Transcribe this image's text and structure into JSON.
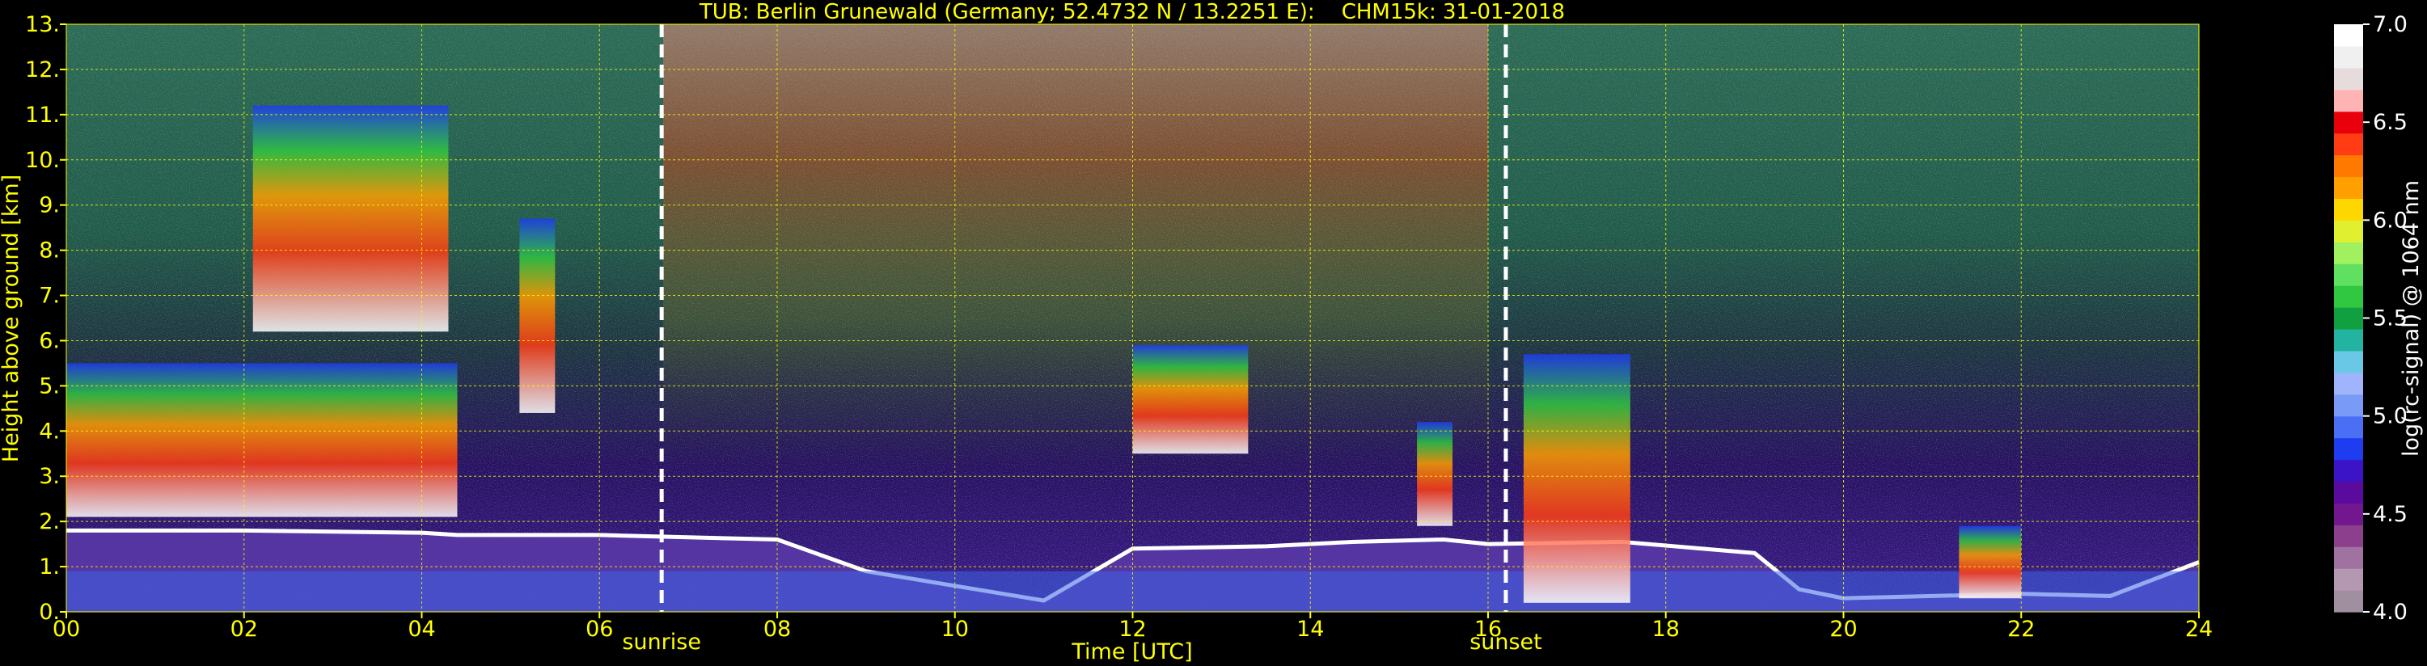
{
  "chart_data": {
    "type": "heatmap",
    "title": "TUB: Berlin Grunewald (Germany; 52.4732 N / 13.2251 E):    CHM15k: 31-01-2018",
    "xlabel": "Time [UTC]",
    "ylabel": "Height above ground [km]",
    "xlim": [
      0,
      24
    ],
    "ylim": [
      0,
      13
    ],
    "x_ticks": [
      "00",
      "02",
      "04",
      "06",
      "08",
      "10",
      "12",
      "14",
      "16",
      "18",
      "20",
      "22",
      "24"
    ],
    "x_tick_values": [
      0,
      2,
      4,
      6,
      8,
      10,
      12,
      14,
      16,
      18,
      20,
      22,
      24
    ],
    "y_ticks": [
      "0.",
      "1.",
      "2.",
      "3.",
      "4.",
      "5.",
      "6.",
      "7.",
      "8.",
      "9.",
      "10.",
      "11.",
      "12.",
      "13."
    ],
    "y_tick_values": [
      0,
      1,
      2,
      3,
      4,
      5,
      6,
      7,
      8,
      9,
      10,
      11,
      12,
      13
    ],
    "grid": true,
    "grid_color": "#ffff00",
    "annotations": [
      {
        "text": "sunrise",
        "x": 6.7
      },
      {
        "text": "sunset",
        "x": 16.2
      }
    ],
    "colorbar": {
      "label": "log(rc-signal) @ 1064 nm",
      "range": [
        4.0,
        7.0
      ],
      "ticks": [
        "4.0",
        "4.5",
        "5.0",
        "5.5",
        "6.0",
        "6.5",
        "7.0"
      ],
      "tick_values": [
        4.0,
        4.5,
        5.0,
        5.5,
        6.0,
        6.5,
        7.0
      ],
      "colors": [
        "#a0909f",
        "#b497b0",
        "#a072a0",
        "#8b3f8d",
        "#73178f",
        "#5a0a9c",
        "#3c14c8",
        "#1e3cf0",
        "#4a6ef4",
        "#7a9af8",
        "#9fb4fa",
        "#68c8e6",
        "#22b4a0",
        "#10a040",
        "#30c840",
        "#60e060",
        "#a0f060",
        "#e0f030",
        "#ffd700",
        "#ffa000",
        "#ff7800",
        "#ff3c14",
        "#e8000a",
        "#ffb4b4",
        "#e6dcdc",
        "#f0f0f0",
        "#ffffff"
      ]
    },
    "features": [
      {
        "type": "boundary_layer_top",
        "time": [
          0,
          2,
          4,
          4.4,
          6,
          8,
          9,
          11,
          12,
          13.5,
          14.5,
          15.5,
          16,
          17.5,
          19,
          19.5,
          20,
          21,
          22,
          23,
          24
        ],
        "height_km": [
          1.8,
          1.8,
          1.75,
          1.7,
          1.7,
          1.6,
          0.9,
          0.25,
          1.4,
          1.45,
          1.55,
          1.6,
          1.5,
          1.55,
          1.3,
          0.5,
          0.3,
          0.35,
          0.4,
          0.35,
          1.1
        ]
      },
      {
        "type": "cirrus",
        "time_range": [
          2.1,
          4.3
        ],
        "height_km": [
          6.2,
          11.2
        ]
      },
      {
        "type": "cirrus",
        "time_range": [
          5.1,
          5.5
        ],
        "height_km": [
          4.4,
          8.7
        ]
      },
      {
        "type": "mid_level_cloud",
        "time_range": [
          0,
          4.4
        ],
        "height_km": [
          2.1,
          5.5
        ]
      },
      {
        "type": "mid_level_cloud",
        "time_range": [
          12.0,
          13.3
        ],
        "height_km": [
          3.5,
          5.9
        ]
      },
      {
        "type": "mid_level_cloud",
        "time_range": [
          15.2,
          15.6
        ],
        "height_km": [
          1.9,
          4.2
        ]
      },
      {
        "type": "low_cloud",
        "time_range": [
          16.4,
          17.6
        ],
        "height_km": [
          0.2,
          5.7
        ]
      },
      {
        "type": "low_cloud",
        "time_range": [
          21.3,
          22.0
        ],
        "height_km": [
          0.3,
          1.9
        ]
      }
    ]
  }
}
